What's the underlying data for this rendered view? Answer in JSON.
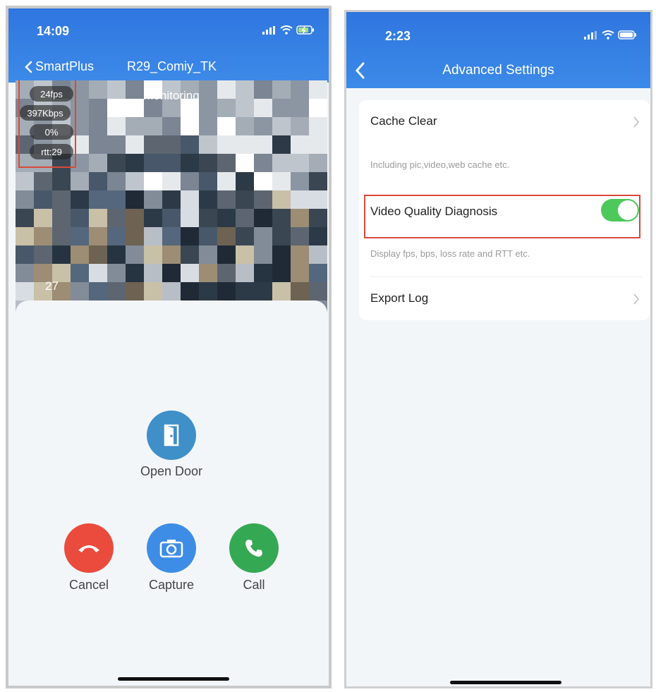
{
  "left_phone": {
    "status_time": "14:09",
    "back_label": "SmartPlus",
    "device_name": "R29_Comiy_TK",
    "video": {
      "label": "Monitoring",
      "stats": [
        "24fps",
        "397Kbps",
        "0%",
        "rtt:29"
      ],
      "overlay_number": "27"
    },
    "actions": {
      "open_door": "Open Door",
      "cancel": "Cancel",
      "capture": "Capture",
      "call": "Call"
    }
  },
  "right_phone": {
    "status_time": "2:23",
    "title": "Advanced Settings",
    "settings": {
      "cache_clear": {
        "title": "Cache Clear",
        "desc": "Including pic,video,web cache etc."
      },
      "video_quality": {
        "title": "Video Quality Diagnosis",
        "desc": "Display fps, bps, loss rate and RTT etc.",
        "enabled": true
      },
      "export_log": {
        "title": "Export Log"
      }
    }
  },
  "colors": {
    "header_blue": "#3580e4",
    "highlight_red": "#d84a3a",
    "cancel_red": "#ea4b3c",
    "capture_blue": "#3d8de6",
    "call_green": "#35a853",
    "door_teal": "#3f8fc9",
    "toggle_green": "#4cc95a"
  },
  "icons": [
    "chevron-left-icon",
    "signal-icon",
    "wifi-icon",
    "battery-icon",
    "door-icon",
    "hang-up-icon",
    "camera-icon",
    "phone-icon",
    "chevron-right-icon"
  ]
}
